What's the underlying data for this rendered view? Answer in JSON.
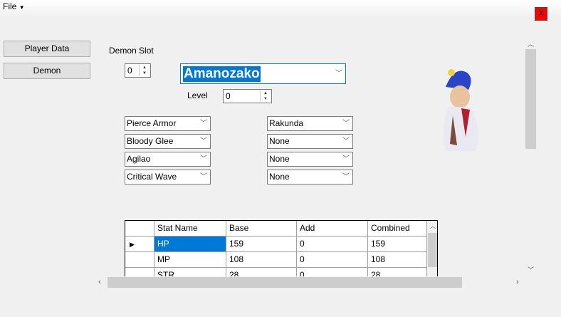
{
  "menu": {
    "file": "File"
  },
  "close_label": "X",
  "nav": {
    "player_data": "Player Data",
    "demon": "Demon"
  },
  "demon_slot": {
    "label": "Demon Slot",
    "value": "0"
  },
  "demon_name": "Amanozako",
  "level": {
    "label": "Level",
    "value": "0"
  },
  "skills_left": [
    "Pierce Armor",
    "Bloody Glee",
    "Agilao",
    "Critical Wave"
  ],
  "skills_right": [
    "Rakunda",
    "None",
    "None",
    "None"
  ],
  "stats": {
    "columns": [
      "Stat Name",
      "Base",
      "Add",
      "Combined"
    ],
    "rows": [
      [
        "HP",
        "159",
        "0",
        "159"
      ],
      [
        "MP",
        "108",
        "0",
        "108"
      ],
      [
        "STR",
        "28",
        "0",
        "28"
      ]
    ]
  },
  "colors": {
    "accent": "#0078d7",
    "close": "#ff0000"
  }
}
